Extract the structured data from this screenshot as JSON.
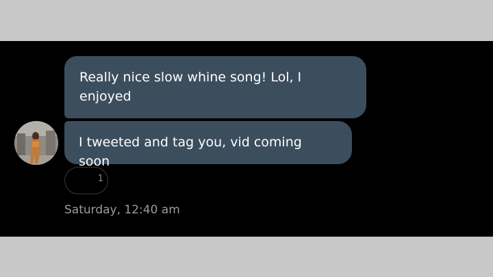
{
  "conversation": {
    "messages": [
      {
        "text": "Really nice slow whine song! Lol, I enjoyed"
      },
      {
        "text": "I tweeted and tag you, vid coming soon"
      }
    ],
    "reaction": {
      "count": "1"
    },
    "timestamp": "Saturday, 12:40 am"
  },
  "colors": {
    "background": "#000000",
    "bubble": "#3c4d5e",
    "letterbox": "#c8c8c8",
    "timestamp": "#9c9c9c"
  }
}
